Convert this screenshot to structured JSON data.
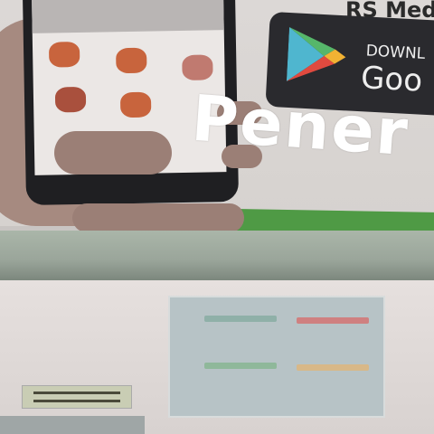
{
  "poster": {
    "brand_text": "RS Med",
    "store_badge": {
      "line1": "DOWNL",
      "line2": "Goo",
      "icon": "google-play-icon"
    }
  },
  "caption": "Pener",
  "colors": {
    "badge": "#2a2a2e",
    "band": "#4f9a45",
    "app_icon": "#c8643d"
  }
}
